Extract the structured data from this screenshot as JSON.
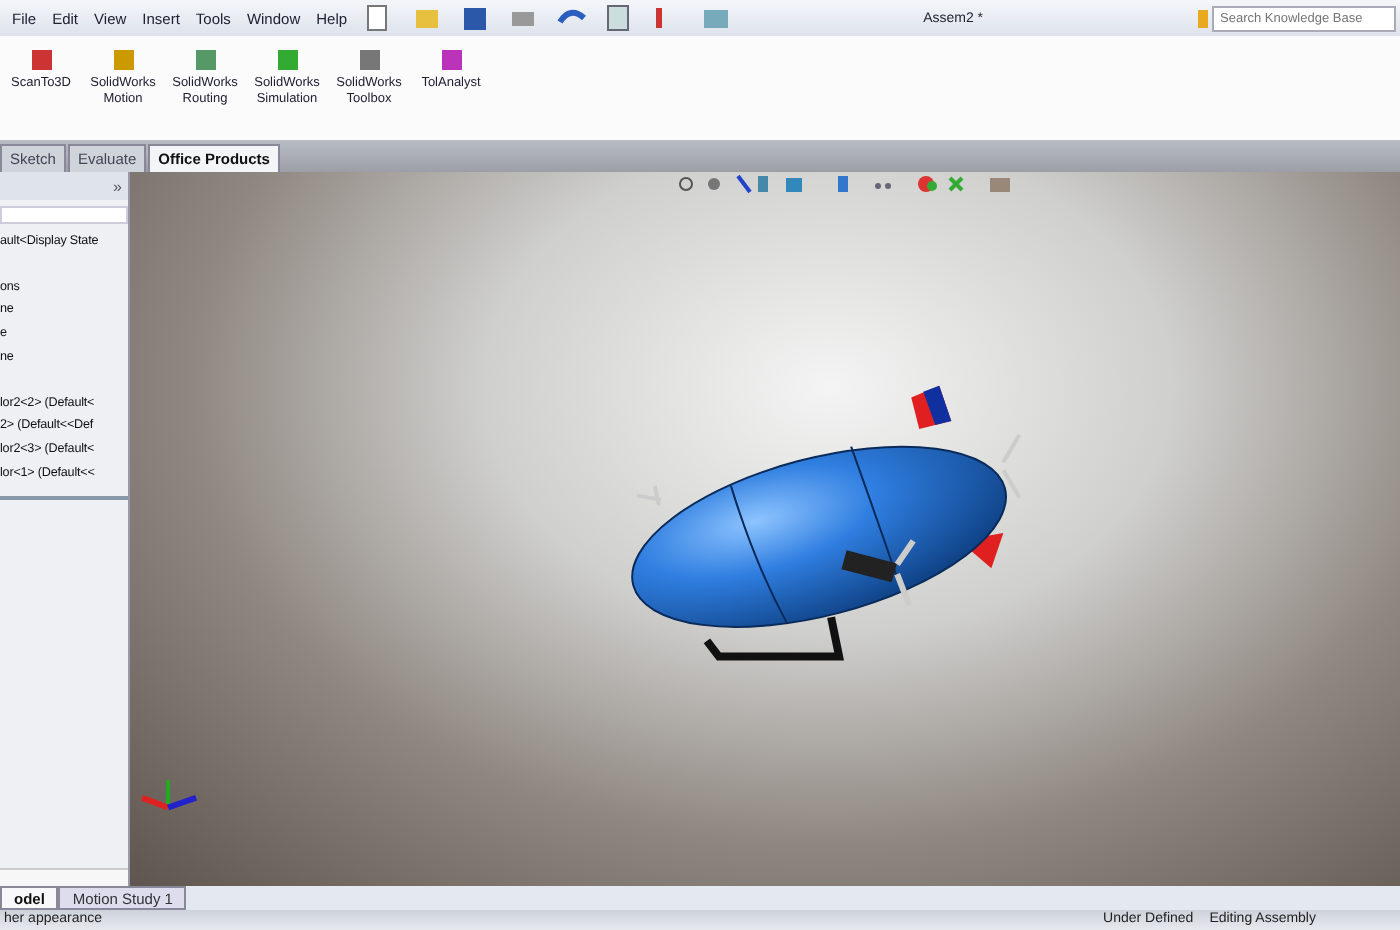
{
  "menu": [
    "File",
    "Edit",
    "View",
    "Insert",
    "Tools",
    "Window",
    "Help"
  ],
  "window": {
    "title": "Assem2 *"
  },
  "search": {
    "placeholder": "Search Knowledge Base"
  },
  "ribbon": [
    {
      "label": "ScanTo3D",
      "kind": "scan"
    },
    {
      "label": "SolidWorks Motion",
      "kind": "motion"
    },
    {
      "label": "SolidWorks Routing",
      "kind": "routing"
    },
    {
      "label": "SolidWorks Simulation",
      "kind": "simulation"
    },
    {
      "label": "SolidWorks Toolbox",
      "kind": "toolbox"
    },
    {
      "label": "TolAnalyst",
      "kind": "tol"
    }
  ],
  "tabs": [
    {
      "label": "Sketch",
      "selected": false
    },
    {
      "label": "Evaluate",
      "selected": false
    },
    {
      "label": "Office Products",
      "selected": true
    }
  ],
  "panel": {
    "collapse": "»",
    "tree_groups": [
      [
        "ault<Display State"
      ],
      [
        "ons",
        "ne",
        "e",
        "ne"
      ],
      [
        "lor2<2> (Default<",
        "2> (Default<<Def",
        "lor2<3> (Default<",
        "lor<1> (Default<<"
      ]
    ]
  },
  "bottom_tabs": [
    {
      "label": "odel",
      "selected": true
    },
    {
      "label": "Motion Study 1",
      "selected": false
    }
  ],
  "status_bar": {
    "hint": "her appearance",
    "state": "Under Defined",
    "mode": "Editing Assembly"
  }
}
